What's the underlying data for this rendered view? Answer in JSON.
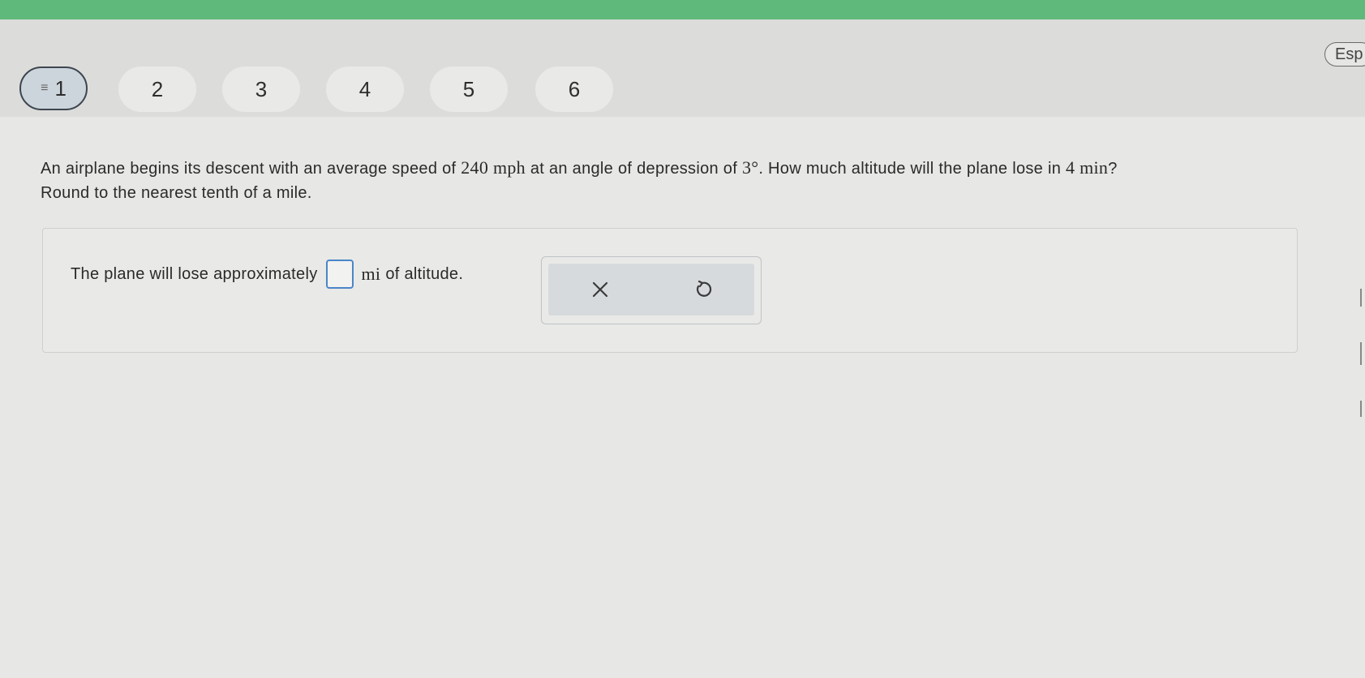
{
  "nav": {
    "questions": [
      {
        "label": "1",
        "active": true
      },
      {
        "label": "2",
        "active": false
      },
      {
        "label": "3",
        "active": false
      },
      {
        "label": "4",
        "active": false
      },
      {
        "label": "5",
        "active": false
      },
      {
        "label": "6",
        "active": false
      }
    ],
    "language_label": "Esp"
  },
  "question": {
    "t1": "An airplane begins its descent with an average speed of ",
    "speed": "240 mph",
    "t2": " at an angle of depression of ",
    "angle": "3°",
    "t3": ". How much altitude will the plane lose in ",
    "time": "4 min",
    "t4": "?",
    "line2": "Round to the nearest tenth of a mile."
  },
  "answer": {
    "prefix": "The plane will lose approximately",
    "unit": "mi",
    "suffix": "of altitude.",
    "input_value": ""
  },
  "tools": {
    "clear_icon": "close-icon",
    "reset_icon": "undo-icon"
  },
  "colors": {
    "top_bar": "#5fb97a",
    "input_border": "#4a86c8",
    "active_border": "#3d4650"
  }
}
